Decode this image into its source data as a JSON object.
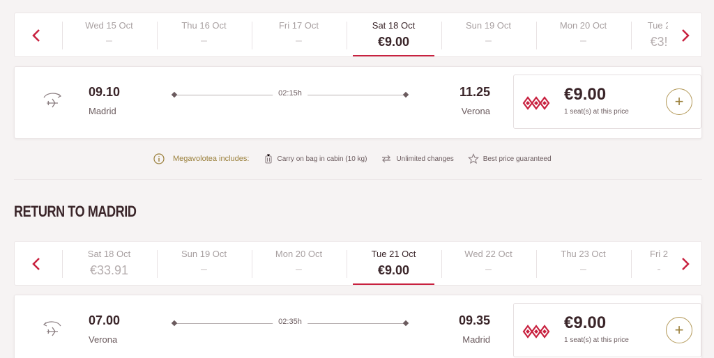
{
  "outbound": {
    "dates": [
      {
        "label": "Wed 15 Oct",
        "price": "–"
      },
      {
        "label": "Thu 16 Oct",
        "price": "–"
      },
      {
        "label": "Fri 17 Oct",
        "price": "–"
      },
      {
        "label": "Sat 18 Oct",
        "price": "€9.00",
        "selected": true
      },
      {
        "label": "Sun 19 Oct",
        "price": "–"
      },
      {
        "label": "Mon 20 Oct",
        "price": "–"
      },
      {
        "label": "Tue 2",
        "price": "€3!"
      }
    ],
    "flight": {
      "dep_time": "09.10",
      "dep_city": "Madrid",
      "duration": "02:15h",
      "arr_time": "11.25",
      "arr_city": "Verona",
      "price": "€9.00",
      "seats": "1 seat(s) at this price"
    }
  },
  "includes": {
    "title": "Megavolotea includes:",
    "items": [
      {
        "icon": "luggage-icon",
        "label": "Carry on bag in cabin (10 kg)"
      },
      {
        "icon": "swap-icon",
        "label": "Unlimited changes"
      },
      {
        "icon": "star-icon",
        "label": "Best price guaranteed"
      }
    ]
  },
  "return_title": "RETURN TO MADRID",
  "return": {
    "dates": [
      {
        "label": "Sat 18 Oct",
        "price": "€33.91"
      },
      {
        "label": "Sun 19 Oct",
        "price": "–"
      },
      {
        "label": "Mon 20 Oct",
        "price": "–"
      },
      {
        "label": "Tue 21 Oct",
        "price": "€9.00",
        "selected": true
      },
      {
        "label": "Wed 22 Oct",
        "price": "–"
      },
      {
        "label": "Thu 23 Oct",
        "price": "–"
      },
      {
        "label": "Fri 2",
        "price": "-"
      }
    ],
    "flight": {
      "dep_time": "07.00",
      "dep_city": "Verona",
      "duration": "02:35h",
      "arr_time": "09.35",
      "arr_city": "Madrid",
      "price": "€9.00",
      "seats": "1 seat(s) at this price"
    }
  },
  "add_label": "+",
  "colors": {
    "accent": "#c8213f",
    "gold": "#9a7f3a",
    "text": "#3a2529"
  }
}
